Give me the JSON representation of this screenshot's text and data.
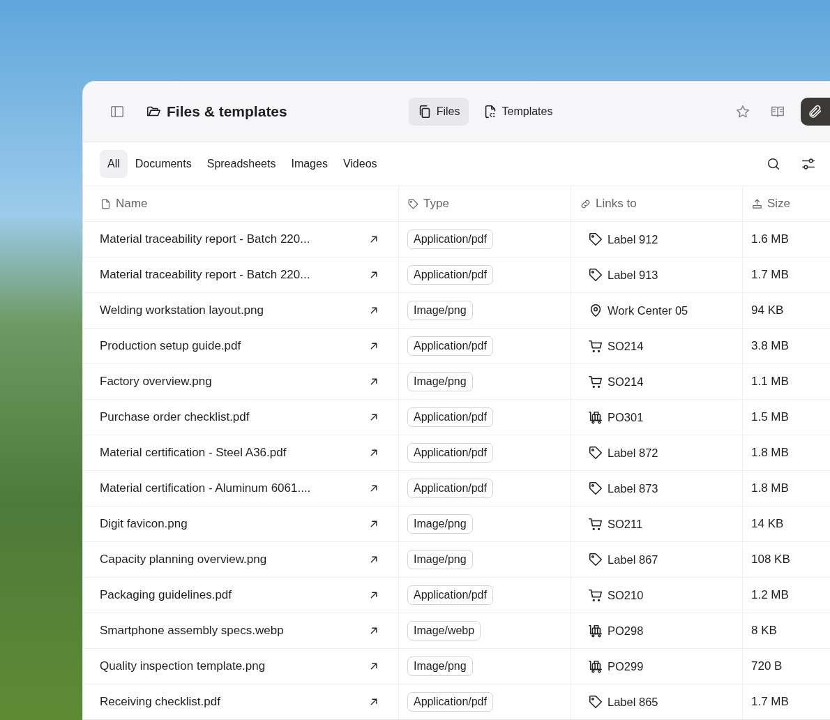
{
  "header": {
    "title": "Files & templates",
    "view_tabs": [
      {
        "label": "Files",
        "selected": true
      },
      {
        "label": "Templates",
        "selected": false
      }
    ],
    "attach_selected": true
  },
  "filters": [
    {
      "label": "All",
      "selected": true
    },
    {
      "label": "Documents",
      "selected": false
    },
    {
      "label": "Spreadsheets",
      "selected": false
    },
    {
      "label": "Images",
      "selected": false
    },
    {
      "label": "Videos",
      "selected": false
    }
  ],
  "table": {
    "columns": [
      "Name",
      "Type",
      "Links to",
      "Size"
    ],
    "rows": [
      {
        "name": "Material traceability report - Batch 220...",
        "type": "Application/pdf",
        "link": {
          "kind": "label",
          "text": "Label 912"
        },
        "size": "1.6 MB"
      },
      {
        "name": "Material traceability report - Batch 220...",
        "type": "Application/pdf",
        "link": {
          "kind": "label",
          "text": "Label 913"
        },
        "size": "1.7 MB"
      },
      {
        "name": "Welding workstation layout.png",
        "type": "Image/png",
        "link": {
          "kind": "location",
          "text": "Work Center 05"
        },
        "size": "94 KB"
      },
      {
        "name": "Production setup guide.pdf",
        "type": "Application/pdf",
        "link": {
          "kind": "sales",
          "text": "SO214"
        },
        "size": "3.8 MB"
      },
      {
        "name": "Factory overview.png",
        "type": "Image/png",
        "link": {
          "kind": "sales",
          "text": "SO214"
        },
        "size": "1.1 MB"
      },
      {
        "name": "Purchase order checklist.pdf",
        "type": "Application/pdf",
        "link": {
          "kind": "purchase",
          "text": "PO301"
        },
        "size": "1.5 MB"
      },
      {
        "name": "Material certification - Steel A36.pdf",
        "type": "Application/pdf",
        "link": {
          "kind": "label",
          "text": "Label 872"
        },
        "size": "1.8 MB"
      },
      {
        "name": "Material certification - Aluminum 6061....",
        "type": "Application/pdf",
        "link": {
          "kind": "label",
          "text": "Label 873"
        },
        "size": "1.8 MB"
      },
      {
        "name": "Digit favicon.png",
        "type": "Image/png",
        "link": {
          "kind": "sales",
          "text": "SO211"
        },
        "size": "14 KB"
      },
      {
        "name": "Capacity planning overview.png",
        "type": "Image/png",
        "link": {
          "kind": "label",
          "text": "Label 867"
        },
        "size": "108 KB"
      },
      {
        "name": "Packaging guidelines.pdf",
        "type": "Application/pdf",
        "link": {
          "kind": "sales",
          "text": "SO210"
        },
        "size": "1.2 MB"
      },
      {
        "name": "Smartphone assembly specs.webp",
        "type": "Image/webp",
        "link": {
          "kind": "purchase",
          "text": "PO298"
        },
        "size": "8 KB"
      },
      {
        "name": "Quality inspection template.png",
        "type": "Image/png",
        "link": {
          "kind": "purchase",
          "text": "PO299"
        },
        "size": "720 B"
      },
      {
        "name": "Receiving checklist.pdf",
        "type": "Application/pdf",
        "link": {
          "kind": "label",
          "text": "Label 865"
        },
        "size": "1.7 MB"
      }
    ]
  }
}
